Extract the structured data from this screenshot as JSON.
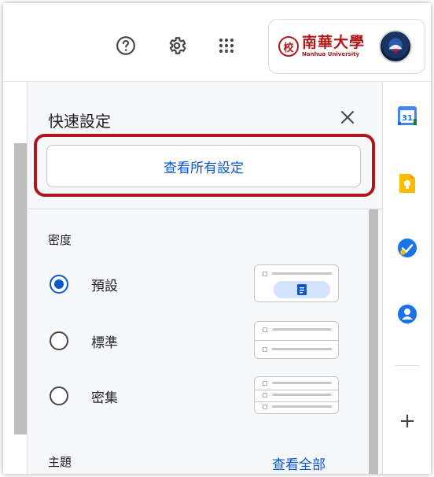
{
  "header": {
    "help_icon": "help-circle-icon",
    "settings_icon": "gear-icon",
    "apps_icon": "apps-grid-icon",
    "logo_cn": "南華大學",
    "logo_en": "Nanhua University",
    "logo_seal": "校"
  },
  "quick_settings": {
    "title": "快速設定",
    "close_icon": "close-icon",
    "see_all_settings": "查看所有設定",
    "density_label": "密度",
    "density_options": [
      {
        "label": "預設",
        "checked": true
      },
      {
        "label": "標準",
        "checked": false
      },
      {
        "label": "密集",
        "checked": false
      }
    ],
    "theme_label": "主題",
    "view_all": "查看全部"
  },
  "side_panel": {
    "calendar_label": "31",
    "icons": [
      "calendar-icon",
      "keep-icon",
      "tasks-icon",
      "contacts-icon"
    ],
    "add_icon": "+"
  },
  "colors": {
    "accent": "#0b57d0",
    "highlight": "#b0151c",
    "brand": "#b01919"
  }
}
